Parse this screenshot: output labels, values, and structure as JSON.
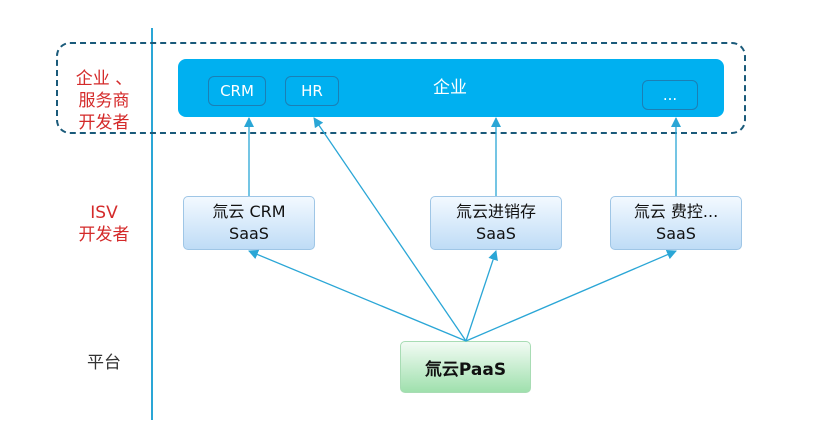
{
  "lanes": {
    "enterprise": [
      "企业 、",
      "服务商",
      "开发者"
    ],
    "isv": [
      "ISV",
      "开发者"
    ],
    "platform": "平台"
  },
  "enterprise": {
    "title": "企业",
    "chips": [
      "CRM",
      "HR",
      "..."
    ]
  },
  "saas": [
    {
      "line1": "氚云 CRM",
      "line2": "SaaS"
    },
    {
      "line1": "氚云进销存",
      "line2": "SaaS"
    },
    {
      "line1": "氚云 费控...",
      "line2": "SaaS"
    }
  ],
  "platform_box": "氚云PaaS",
  "colors": {
    "lane_label_red": "#d42a2a",
    "enterprise_bar": "#00b0f0",
    "arrow": "#2aa6d6",
    "divider": "#2aa6d6"
  }
}
